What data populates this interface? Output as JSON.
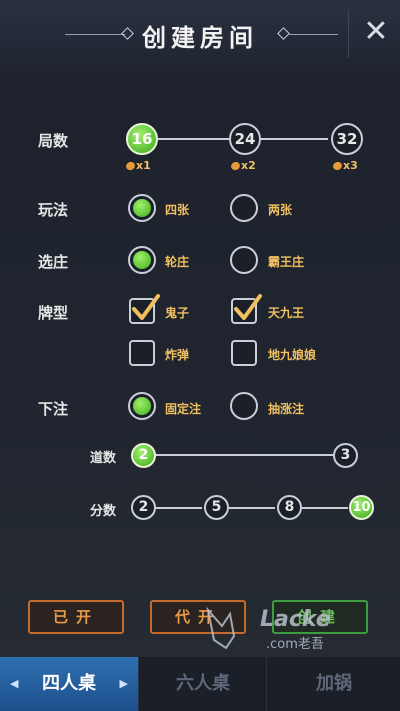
{
  "header": {
    "title": "创建房间",
    "close_icon": "close-icon"
  },
  "rounds": {
    "label": "局数",
    "options": [
      "16",
      "24",
      "32"
    ],
    "selected": "16",
    "costs": [
      "x1",
      "x2",
      "x3"
    ]
  },
  "play_mode": {
    "label": "玩法",
    "options": [
      "四张",
      "两张"
    ],
    "selected": "四张"
  },
  "banker": {
    "label": "选庄",
    "options": [
      "轮庄",
      "霸王庄"
    ],
    "selected": "轮庄"
  },
  "card_types": {
    "label": "牌型",
    "options": [
      "鬼子",
      "天九王",
      "炸弹",
      "地九娘娘"
    ],
    "checked": [
      "鬼子",
      "天九王"
    ]
  },
  "bet": {
    "label": "下注",
    "options": [
      "固定注",
      "抽涨注"
    ],
    "selected": "固定注",
    "lanes": {
      "label": "道数",
      "options": [
        "2",
        "3"
      ],
      "selected": "2"
    },
    "points": {
      "label": "分数",
      "options": [
        "2",
        "5",
        "8",
        "10"
      ],
      "selected": "10"
    }
  },
  "actions": {
    "opened": "已开",
    "proxy": "代开",
    "create": "创建"
  },
  "watermark": {
    "text": "Lacke",
    "subtext": ".com老吾"
  },
  "tabs": {
    "items": [
      "四人桌",
      "六人桌",
      "加锅"
    ],
    "selected": "四人桌"
  },
  "colors": {
    "accent_green": "#3fae1c",
    "option_gold": "#f0c060",
    "button_orange": "#c56a2a",
    "tab_blue": "#2f6fb0"
  }
}
